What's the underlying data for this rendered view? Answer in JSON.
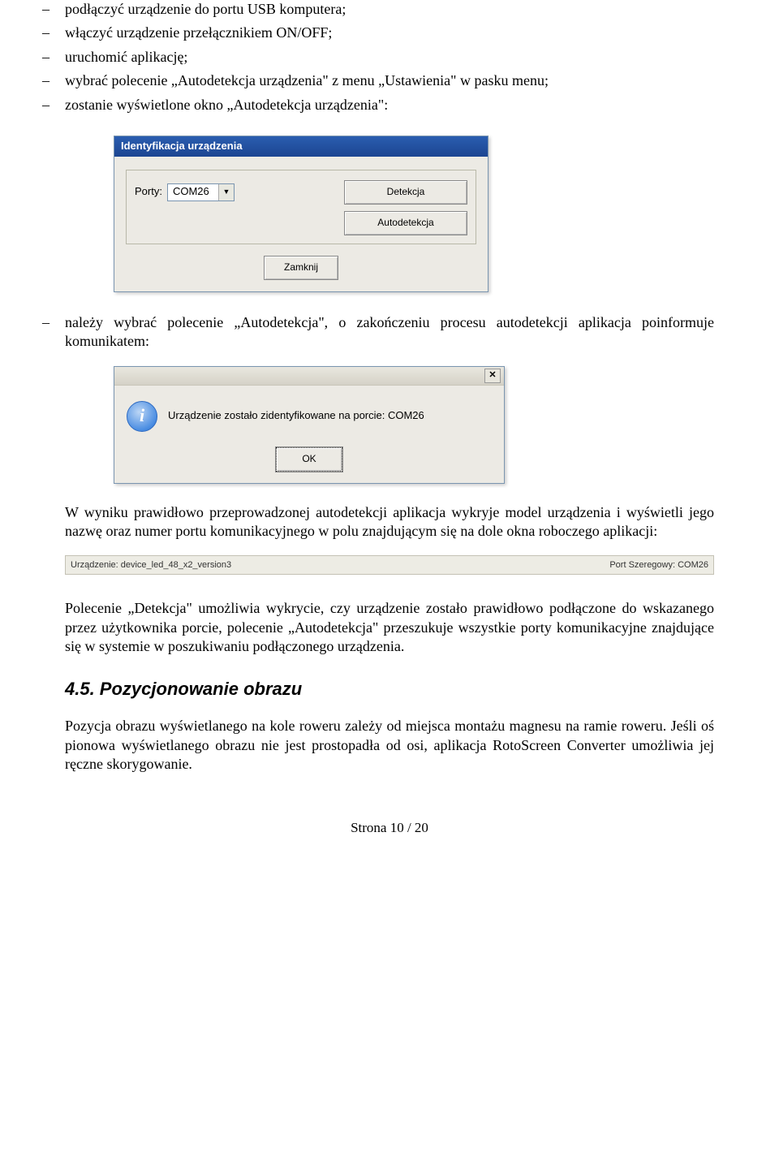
{
  "bullets1": [
    "podłączyć urządzenie do portu USB komputera;",
    "włączyć urządzenie przełącznikiem ON/OFF;",
    "uruchomić aplikację;",
    "wybrać polecenie „Autodetekcja urządzenia\" z menu „Ustawienia\" w pasku menu;",
    "zostanie wyświetlone okno „Autodetekcja urządzenia\":"
  ],
  "dialog1": {
    "title": "Identyfikacja urządzenia",
    "port_label": "Porty:",
    "port_value": "COM26",
    "detekcja": "Detekcja",
    "autodetekcja": "Autodetekcja",
    "zamknij": "Zamknij"
  },
  "bullets2": [
    "należy wybrać polecenie „Autodetekcja\", o zakończeniu procesu autodetekcji aplikacja poinformuje komunikatem:"
  ],
  "dialog2": {
    "message": "Urządzenie zostało zidentyfikowane na porcie: COM26",
    "ok": "OK",
    "close": "✕"
  },
  "para_wynik": "W wyniku prawidłowo przeprowadzonej autodetekcji aplikacja wykryje model urządzenia i wyświetli jego nazwę oraz numer portu komunikacyjnego w polu znajdującym się na dole okna roboczego aplikacji:",
  "statusbar": {
    "left": "Urządzenie: device_led_48_x2_version3",
    "right": "Port Szeregowy: COM26"
  },
  "para_polecenie": "Polecenie „Detekcja\" umożliwia wykrycie, czy urządzenie zostało prawidłowo podłączone do wskazanego przez użytkownika porcie, polecenie „Autodetekcja\" przeszukuje wszystkie porty komunikacyjne znajdujące się w systemie w poszukiwaniu podłączonego urządzenia.",
  "heading": "4.5. Pozycjonowanie obrazu",
  "para_pozycja": "Pozycja obrazu wyświetlanego na kole roweru zależy od miejsca montażu magnesu na ramie roweru. Jeśli oś pionowa wyświetlanego obrazu nie jest prostopadła od osi, aplikacja RotoScreen Converter umożliwia jej ręczne skorygowanie.",
  "footer": "Strona 10 / 20",
  "bullet_marker": "–"
}
